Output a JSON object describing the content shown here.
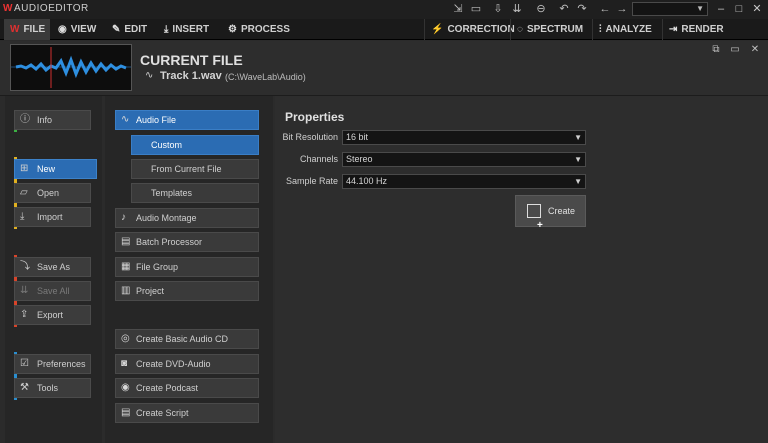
{
  "app": {
    "title": "AUDIOEDITOR"
  },
  "tabs": [
    {
      "label": "FILE",
      "icon": "wave-icon"
    },
    {
      "label": "VIEW",
      "icon": "eye-icon"
    },
    {
      "label": "EDIT",
      "icon": "pencil-icon"
    },
    {
      "label": "INSERT",
      "icon": "insert-icon"
    },
    {
      "label": "PROCESS",
      "icon": "gears-icon"
    }
  ],
  "right_tabs": [
    {
      "label": "CORRECTION",
      "icon": "bolt-icon"
    },
    {
      "label": "SPECTRUM",
      "icon": "spectrum-icon"
    },
    {
      "label": "ANALYZE",
      "icon": "analyze-icon"
    },
    {
      "label": "RENDER",
      "icon": "render-icon"
    }
  ],
  "header": {
    "title": "CURRENT FILE",
    "track_name": "Track 1.wav",
    "track_path": "(C:\\WaveLab\\Audio)"
  },
  "left_menu": {
    "info": "Info",
    "new": "New",
    "open": "Open",
    "import": "Import",
    "save_as": "Save As",
    "save_all": "Save All",
    "export": "Export",
    "preferences": "Preferences",
    "tools": "Tools"
  },
  "mid_menu": {
    "audio_file": "Audio File",
    "custom": "Custom",
    "from_current_file": "From Current File",
    "templates": "Templates",
    "audio_montage": "Audio Montage",
    "batch_processor": "Batch Processor",
    "file_group": "File Group",
    "project": "Project",
    "create_basic_audio_cd": "Create Basic Audio CD",
    "create_dvd_audio": "Create DVD-Audio",
    "create_podcast": "Create Podcast",
    "create_script": "Create Script"
  },
  "properties": {
    "title": "Properties",
    "bit_resolution_label": "Bit Resolution",
    "bit_resolution_value": "16 bit",
    "channels_label": "Channels",
    "channels_value": "Stereo",
    "sample_rate_label": "Sample Rate",
    "sample_rate_value": "44.100 Hz",
    "create_label": "Create"
  },
  "colors": {
    "accent_blue": "#2b6cb3",
    "stripe_green": "#3cb043",
    "stripe_yellow": "#e0b020",
    "stripe_red": "#d8442a",
    "stripe_blue": "#2a8fd0",
    "logo_red": "#e03030"
  }
}
